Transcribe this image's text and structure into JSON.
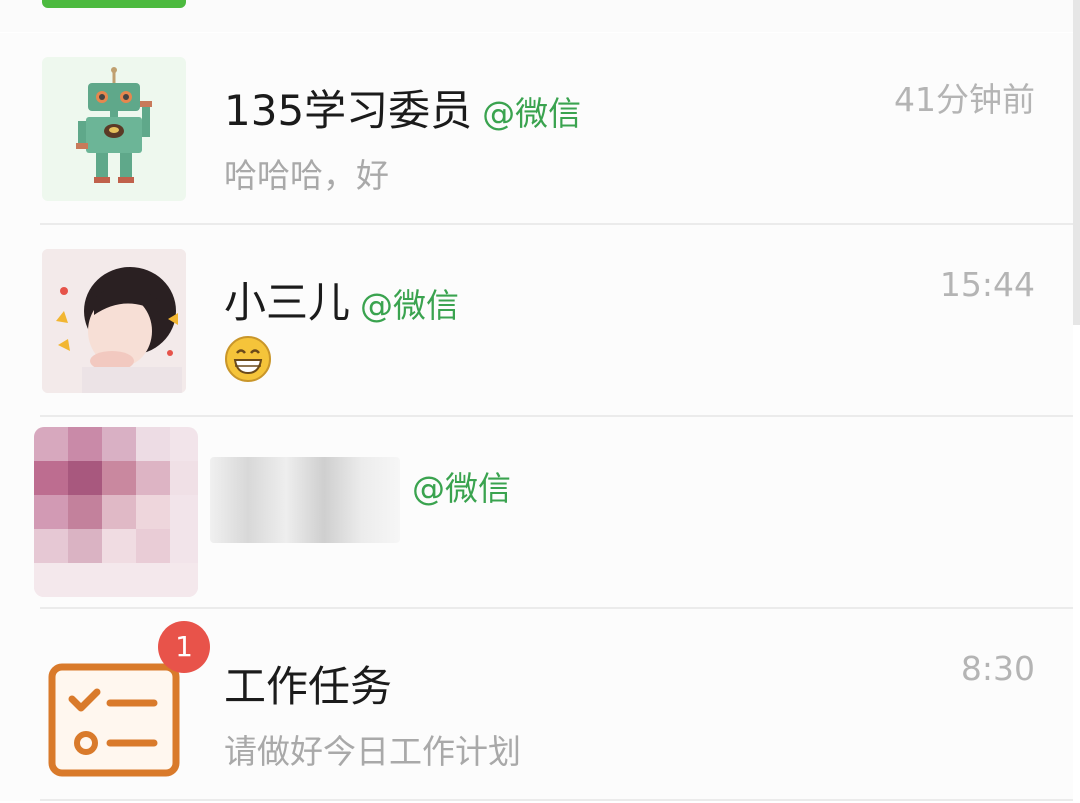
{
  "chats": [
    {
      "name": "135学习委员",
      "tag": "@微信",
      "time": "41分钟前",
      "preview": "哈哈哈，好",
      "avatar_icon": "robot-icon"
    },
    {
      "name": "小三儿",
      "tag": "@微信",
      "time": "15:44",
      "preview_icon": "grin-emoji-icon",
      "avatar_icon": "girl-photo-avatar"
    },
    {
      "name": "",
      "tag": "@微信",
      "time": "",
      "preview": "",
      "avatar_icon": "blurred-avatar"
    },
    {
      "name": "工作任务",
      "tag": "",
      "time": "8:30",
      "preview": "请做好今日工作计划",
      "badge": "1",
      "avatar_icon": "task-list-icon"
    }
  ],
  "colors": {
    "tag_green": "#3aa34f",
    "badge_red": "#e8534a",
    "task_orange": "#d97a2b",
    "top_button_green": "#4cba3f"
  }
}
